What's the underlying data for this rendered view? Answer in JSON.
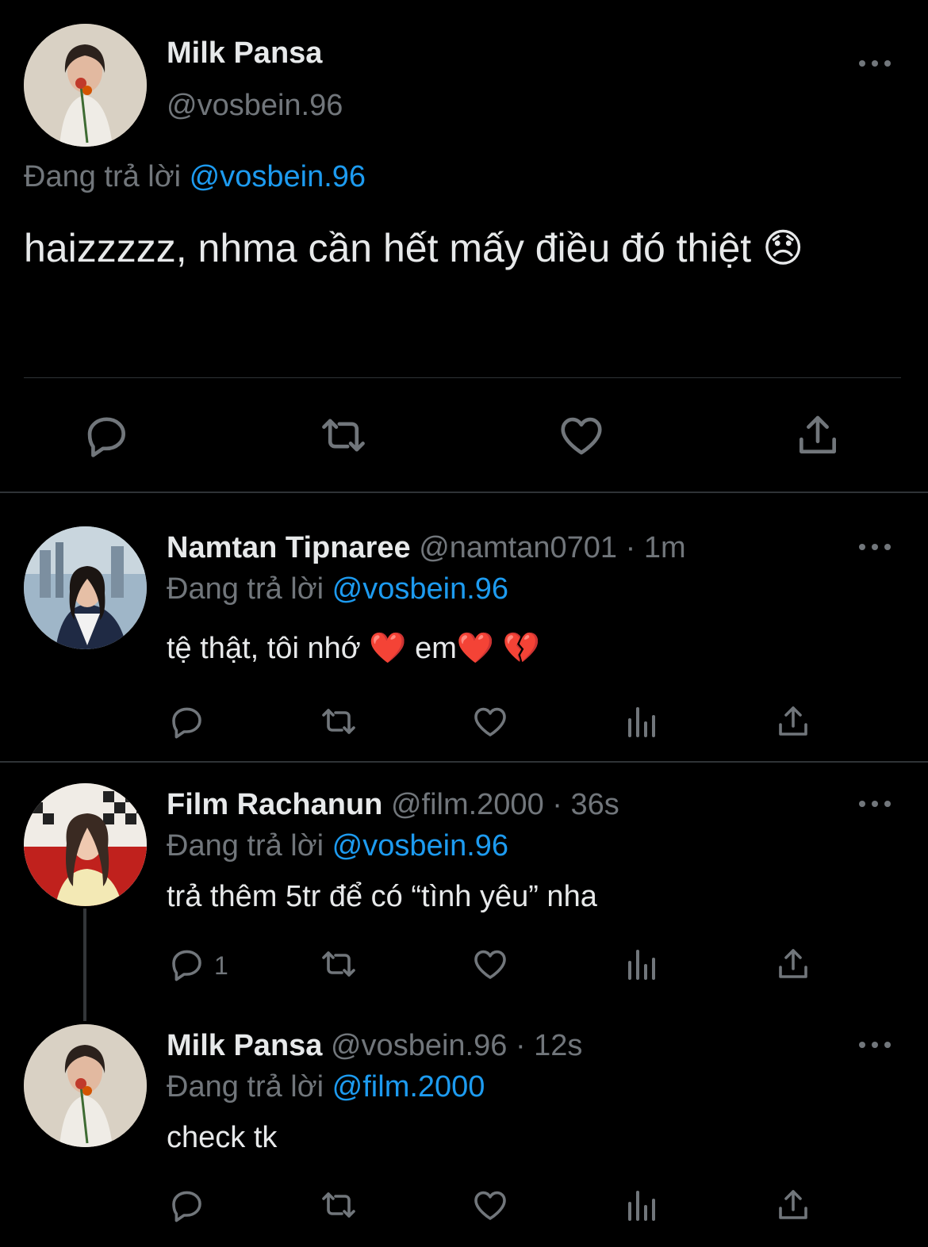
{
  "main_tweet": {
    "name": "Milk Pansa",
    "handle": "@vosbein.96",
    "replying_prefix": "Đang trả lời",
    "replying_to": "@vosbein.96",
    "text": "haizzzzz, nhma cần hết mấy điều đó thiệt",
    "emoji": "😞",
    "avatar_icon": "woman-with-flower-avatar"
  },
  "replies": [
    {
      "name": "Namtan Tipnaree",
      "handle": "@namtan0701",
      "sep": "·",
      "time": "1m",
      "replying_prefix": "Đang trả lời",
      "replying_to": "@vosbein.96",
      "text_a": "tệ thật, tôi nhớ ",
      "emoji_a": "❤️",
      "text_b": " em",
      "emoji_b": "❤️",
      "emoji_c": "💔",
      "reply_count": ""
    },
    {
      "name": "Film Rachanun",
      "handle": "@film.2000",
      "sep": "·",
      "time": "36s",
      "replying_prefix": "Đang trả lời",
      "replying_to": "@vosbein.96",
      "text": "trả thêm 5tr để có “tình yêu” nha",
      "reply_count": "1"
    },
    {
      "name": "Milk Pansa",
      "handle": "@vosbein.96",
      "sep": "·",
      "time": "12s",
      "replying_prefix": "Đang trả lời",
      "replying_to": "@film.2000",
      "text": "check tk",
      "reply_count": ""
    }
  ],
  "colors": {
    "background": "#000000",
    "text": "#e7e9ea",
    "muted": "#71767b",
    "link": "#1d9bf0",
    "divider": "#2f3336"
  }
}
